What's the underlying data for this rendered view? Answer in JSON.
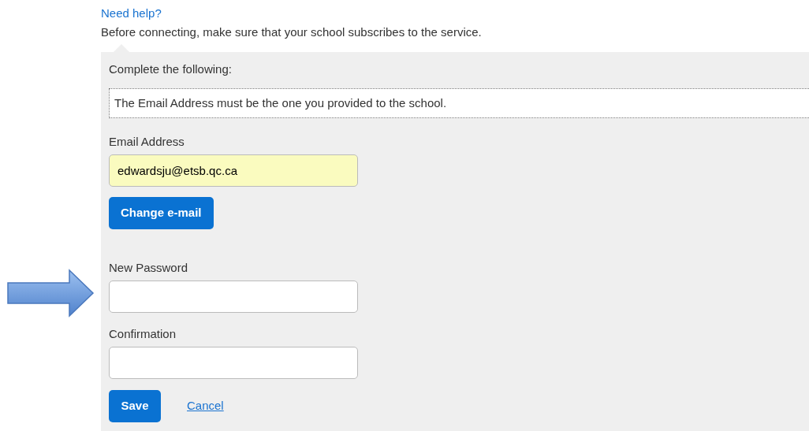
{
  "help_link": "Need help?",
  "intro": "Before connecting, make sure that your school subscribes to the service.",
  "panel": {
    "heading": "Complete the following:",
    "notice": "The Email Address must be the one you provided to the school.",
    "email": {
      "label": "Email Address",
      "value": "edwardsju@etsb.qc.ca",
      "autofilled": true
    },
    "change_button": "Change e-mail",
    "password_fields": [
      {
        "label": "New Password"
      },
      {
        "label": "Confirmation"
      }
    ],
    "save_button": "Save",
    "cancel_link": "Cancel"
  }
}
